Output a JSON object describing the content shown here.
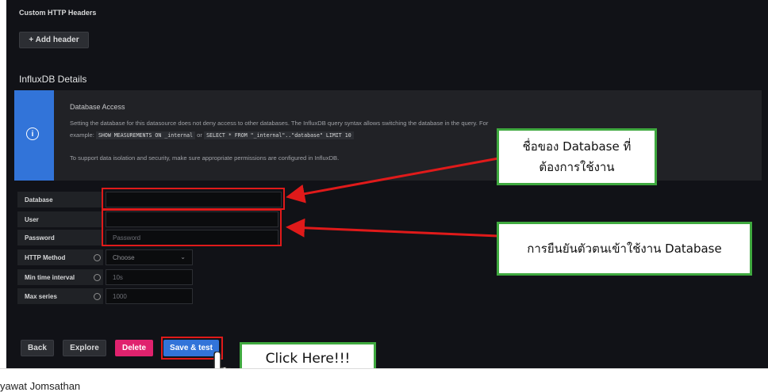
{
  "headers_section": {
    "title": "Custom HTTP Headers",
    "add_header_label": "+ Add header"
  },
  "influx_section": {
    "title": "InfluxDB Details"
  },
  "info": {
    "icon": "info-circle-icon",
    "title": "Database Access",
    "line1": "Setting the database for this datasource does not deny access to other databases. The InfluxDB query syntax allows switching the database in the query. For",
    "example_label": "example:",
    "code1": "SHOW MEASUREMENTS ON _internal",
    "or_label": "or",
    "code2": "SELECT * FROM \"_internal\"..\"database\" LIMIT 10",
    "line3": "To support data isolation and security, make sure appropriate permissions are configured in InfluxDB."
  },
  "fields": {
    "database": {
      "label": "Database",
      "value": ""
    },
    "user": {
      "label": "User",
      "value": ""
    },
    "password": {
      "label": "Password",
      "placeholder": "Password"
    },
    "http_method": {
      "label": "HTTP Method",
      "value": "Choose"
    },
    "min_time_interval": {
      "label": "Min time interval",
      "value": "10s"
    },
    "max_series": {
      "label": "Max series",
      "value": "1000"
    }
  },
  "actions": {
    "back": "Back",
    "explore": "Explore",
    "delete": "Delete",
    "save_test": "Save & test"
  },
  "annotations": {
    "database_note_line1": "ชื่อของ Database ที่",
    "database_note_line2": "ต้องการใช้งาน",
    "auth_note": "การยืนยันตัวตนเข้าใช้งาน Database",
    "click_here": "Click Here!!!"
  },
  "footer": {
    "author_text": "yawat Jomsathan"
  },
  "colors": {
    "accent_blue": "#3274d9",
    "delete_pink": "#e0226e",
    "annotation_red": "#e01a1a",
    "callout_green": "#3fa93f"
  }
}
